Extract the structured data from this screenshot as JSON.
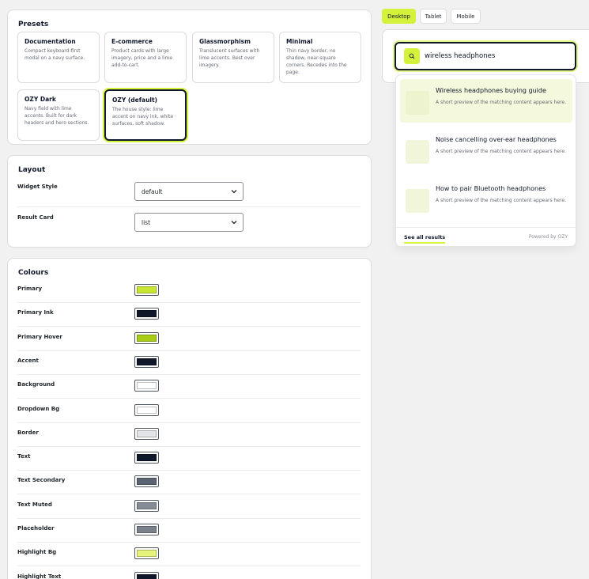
{
  "presets": {
    "title": "Presets",
    "items": [
      {
        "name": "Documentation",
        "desc": "Compact keyboard-first modal on a navy surface."
      },
      {
        "name": "E-commerce",
        "desc": "Product cards with large imagery, price and a lime add-to-cart."
      },
      {
        "name": "Glassmorphism",
        "desc": "Translucent surfaces with lime accents. Best over imagery."
      },
      {
        "name": "Minimal",
        "desc": "Thin navy border, no shadow, near-square corners. Recedes into the page."
      },
      {
        "name": "OZY Dark",
        "desc": "Navy field with lime accents. Built for dark headers and hero sections."
      },
      {
        "name": "OZY (default)",
        "desc": "The house style: lime accent on navy ink, white surfaces, soft shadow."
      }
    ],
    "active": "OZY (default)"
  },
  "layout": {
    "title": "Layout",
    "widget_style": {
      "label": "Widget Style",
      "value": "default"
    },
    "result_card": {
      "label": "Result Card",
      "value": "list"
    }
  },
  "colours": {
    "title": "Colours",
    "items": [
      {
        "label": "Primary",
        "color": "#c8e632"
      },
      {
        "label": "Primary Ink",
        "color": "#0f172a"
      },
      {
        "label": "Primary Hover",
        "color": "#a8cc16"
      },
      {
        "label": "Accent",
        "color": "#0f172a"
      },
      {
        "label": "Background",
        "color": "#ffffff"
      },
      {
        "label": "Dropdown Bg",
        "color": "#ffffff"
      },
      {
        "label": "Border",
        "color": "#e2e4e7"
      },
      {
        "label": "Text",
        "color": "#0f172a"
      },
      {
        "label": "Text Secondary",
        "color": "#5b6472"
      },
      {
        "label": "Text Muted",
        "color": "#858c96"
      },
      {
        "label": "Placeholder",
        "color": "#7b818b"
      },
      {
        "label": "Highlight Bg",
        "color": "#e6f57a"
      },
      {
        "label": "Highlight Text",
        "color": "#0f172a"
      }
    ]
  },
  "preview": {
    "tabs": [
      "Desktop",
      "Tablet",
      "Mobile"
    ],
    "active_tab": "Desktop",
    "search_query": "wireless headphones",
    "results": [
      {
        "title": "Wireless headphones buying guide",
        "desc": "A short preview of the matching content appears here."
      },
      {
        "title": "Noise cancelling over-ear headphones",
        "desc": "A short preview of the matching content appears here."
      },
      {
        "title": "How to pair Bluetooth headphones",
        "desc": "A short preview of the matching content appears here."
      }
    ],
    "see_all": "See all results",
    "powered_by": "Powered by OZY"
  },
  "accent_color": "#d4f23a",
  "ink_color": "#0f172a"
}
